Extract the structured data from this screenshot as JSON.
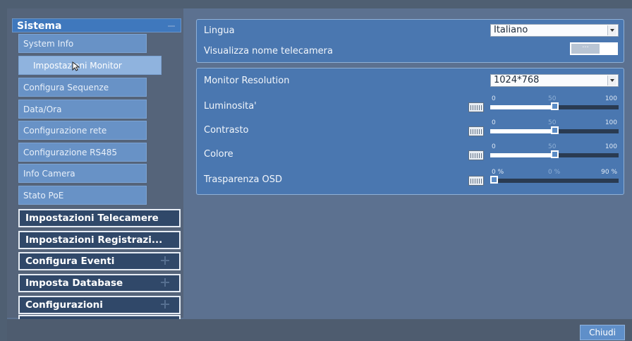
{
  "sidebar": {
    "section": {
      "label": "Sistema"
    },
    "items": [
      {
        "label": "System Info"
      },
      {
        "label": "Impostazioni Monitor",
        "active": true
      },
      {
        "label": "Configura Sequenze"
      },
      {
        "label": "Data/Ora"
      },
      {
        "label": "Configurazione rete"
      },
      {
        "label": "Configurazione RS485"
      },
      {
        "label": "Info Camera"
      },
      {
        "label": "Stato PoE"
      }
    ],
    "categories": [
      {
        "label": "Impostazioni Telecamere"
      },
      {
        "label": "Impostazioni Registrazi..."
      },
      {
        "label": "Configura Eventi"
      },
      {
        "label": "Imposta Database"
      },
      {
        "label": "Configurazioni"
      }
    ]
  },
  "general": {
    "language_label": "Lingua",
    "language_value": "Italiano",
    "show_camera_name_label": "Visualizza nome telecamera",
    "show_camera_name_toggle": "···"
  },
  "monitor": {
    "resolution_label": "Monitor Resolution",
    "resolution_value": "1024*768",
    "sliders": [
      {
        "label": "Luminosita'",
        "min": "0",
        "mid": "50",
        "max": "100",
        "value": 50,
        "range": [
          0,
          100
        ]
      },
      {
        "label": "Contrasto",
        "min": "0",
        "mid": "50",
        "max": "100",
        "value": 50,
        "range": [
          0,
          100
        ]
      },
      {
        "label": "Colore",
        "min": "0",
        "mid": "50",
        "max": "100",
        "value": 50,
        "range": [
          0,
          100
        ]
      },
      {
        "label": "Trasparenza OSD",
        "min": "0 %",
        "mid": "0 %",
        "max": "90 %",
        "value": 0,
        "range": [
          0,
          90
        ]
      }
    ]
  },
  "footer": {
    "close_label": "Chiudi"
  },
  "colors": {
    "panel": "#4a77b0",
    "accent": "#3f78bd",
    "category_bg": "#304869"
  }
}
